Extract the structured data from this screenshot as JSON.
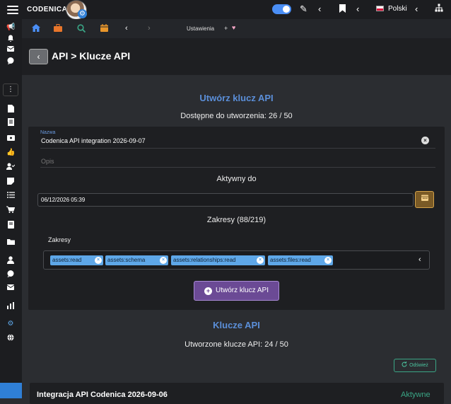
{
  "topbar": {
    "brand": "CODENICA",
    "language": "Polski"
  },
  "secbar": {
    "crumb": "Ustawienia",
    "plus": "+",
    "heart": "♥"
  },
  "header": {
    "title": "API > Klucze API",
    "back_icon": "chevron-left-icon"
  },
  "create_section": {
    "title": "Utwórz klucz API",
    "available": "Dostępne do utworzenia: 26 / 50",
    "name_label": "Nazwa",
    "name_value": "Codenica API integration 2026-09-07",
    "description_placeholder": "Opis",
    "active_until_label": "Aktywny do",
    "active_until_value": "06/12/2026 05:39",
    "scopes_heading": "Zakresy (88/219)",
    "scopes_label": "Zakresy",
    "scopes": [
      "assets:read",
      "assets:schema",
      "assets:relationships:read",
      "assets:files:read"
    ],
    "create_button": "Utwórz klucz API"
  },
  "keys_section": {
    "title": "Klucze API",
    "created": "Utworzone klucze API: 24 / 50",
    "refresh_button": "Odśwież",
    "first_key_name": "Integracja API Codenica 2026-09-06",
    "first_key_status": "Aktywne"
  },
  "colors": {
    "accent_blue": "#5b8fd9",
    "primary_purple": "#6b4a95",
    "status_green": "#3aa585",
    "calendar_gold": "#d4a24a"
  }
}
